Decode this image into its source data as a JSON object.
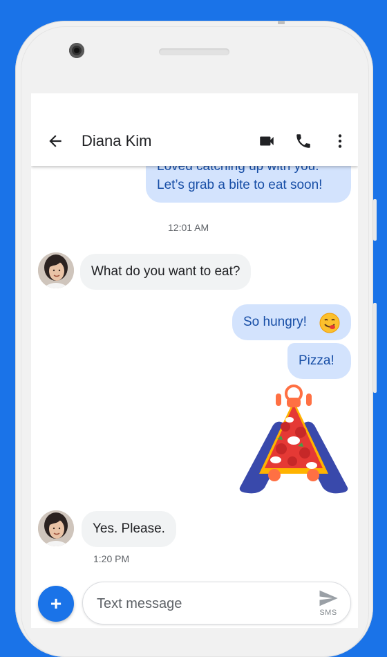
{
  "header": {
    "contact_name": "Diana Kim",
    "icons": [
      "back-arrow-icon",
      "video-call-icon",
      "phone-call-icon",
      "more-vert-icon"
    ]
  },
  "messages": {
    "first_out_line1": "Loved catching up with you.",
    "first_out_line2": "Let’s grab a bite to eat soon!",
    "timestamp_1": "12:01 AM",
    "incoming_1": "What do you want to eat?",
    "outgoing_2": "So hungry!",
    "outgoing_2_emoji": "😋",
    "outgoing_3": "Pizza!",
    "incoming_2": "Yes. Please.",
    "timestamp_2": "1:20 PM"
  },
  "compose": {
    "placeholder": "Text message",
    "send_label": "SMS",
    "add_label": "+"
  },
  "colors": {
    "background": "#1a73e8",
    "outgoing_bubble": "#d3e3fd",
    "incoming_bubble": "#f1f3f4",
    "accent": "#1a73e8"
  }
}
